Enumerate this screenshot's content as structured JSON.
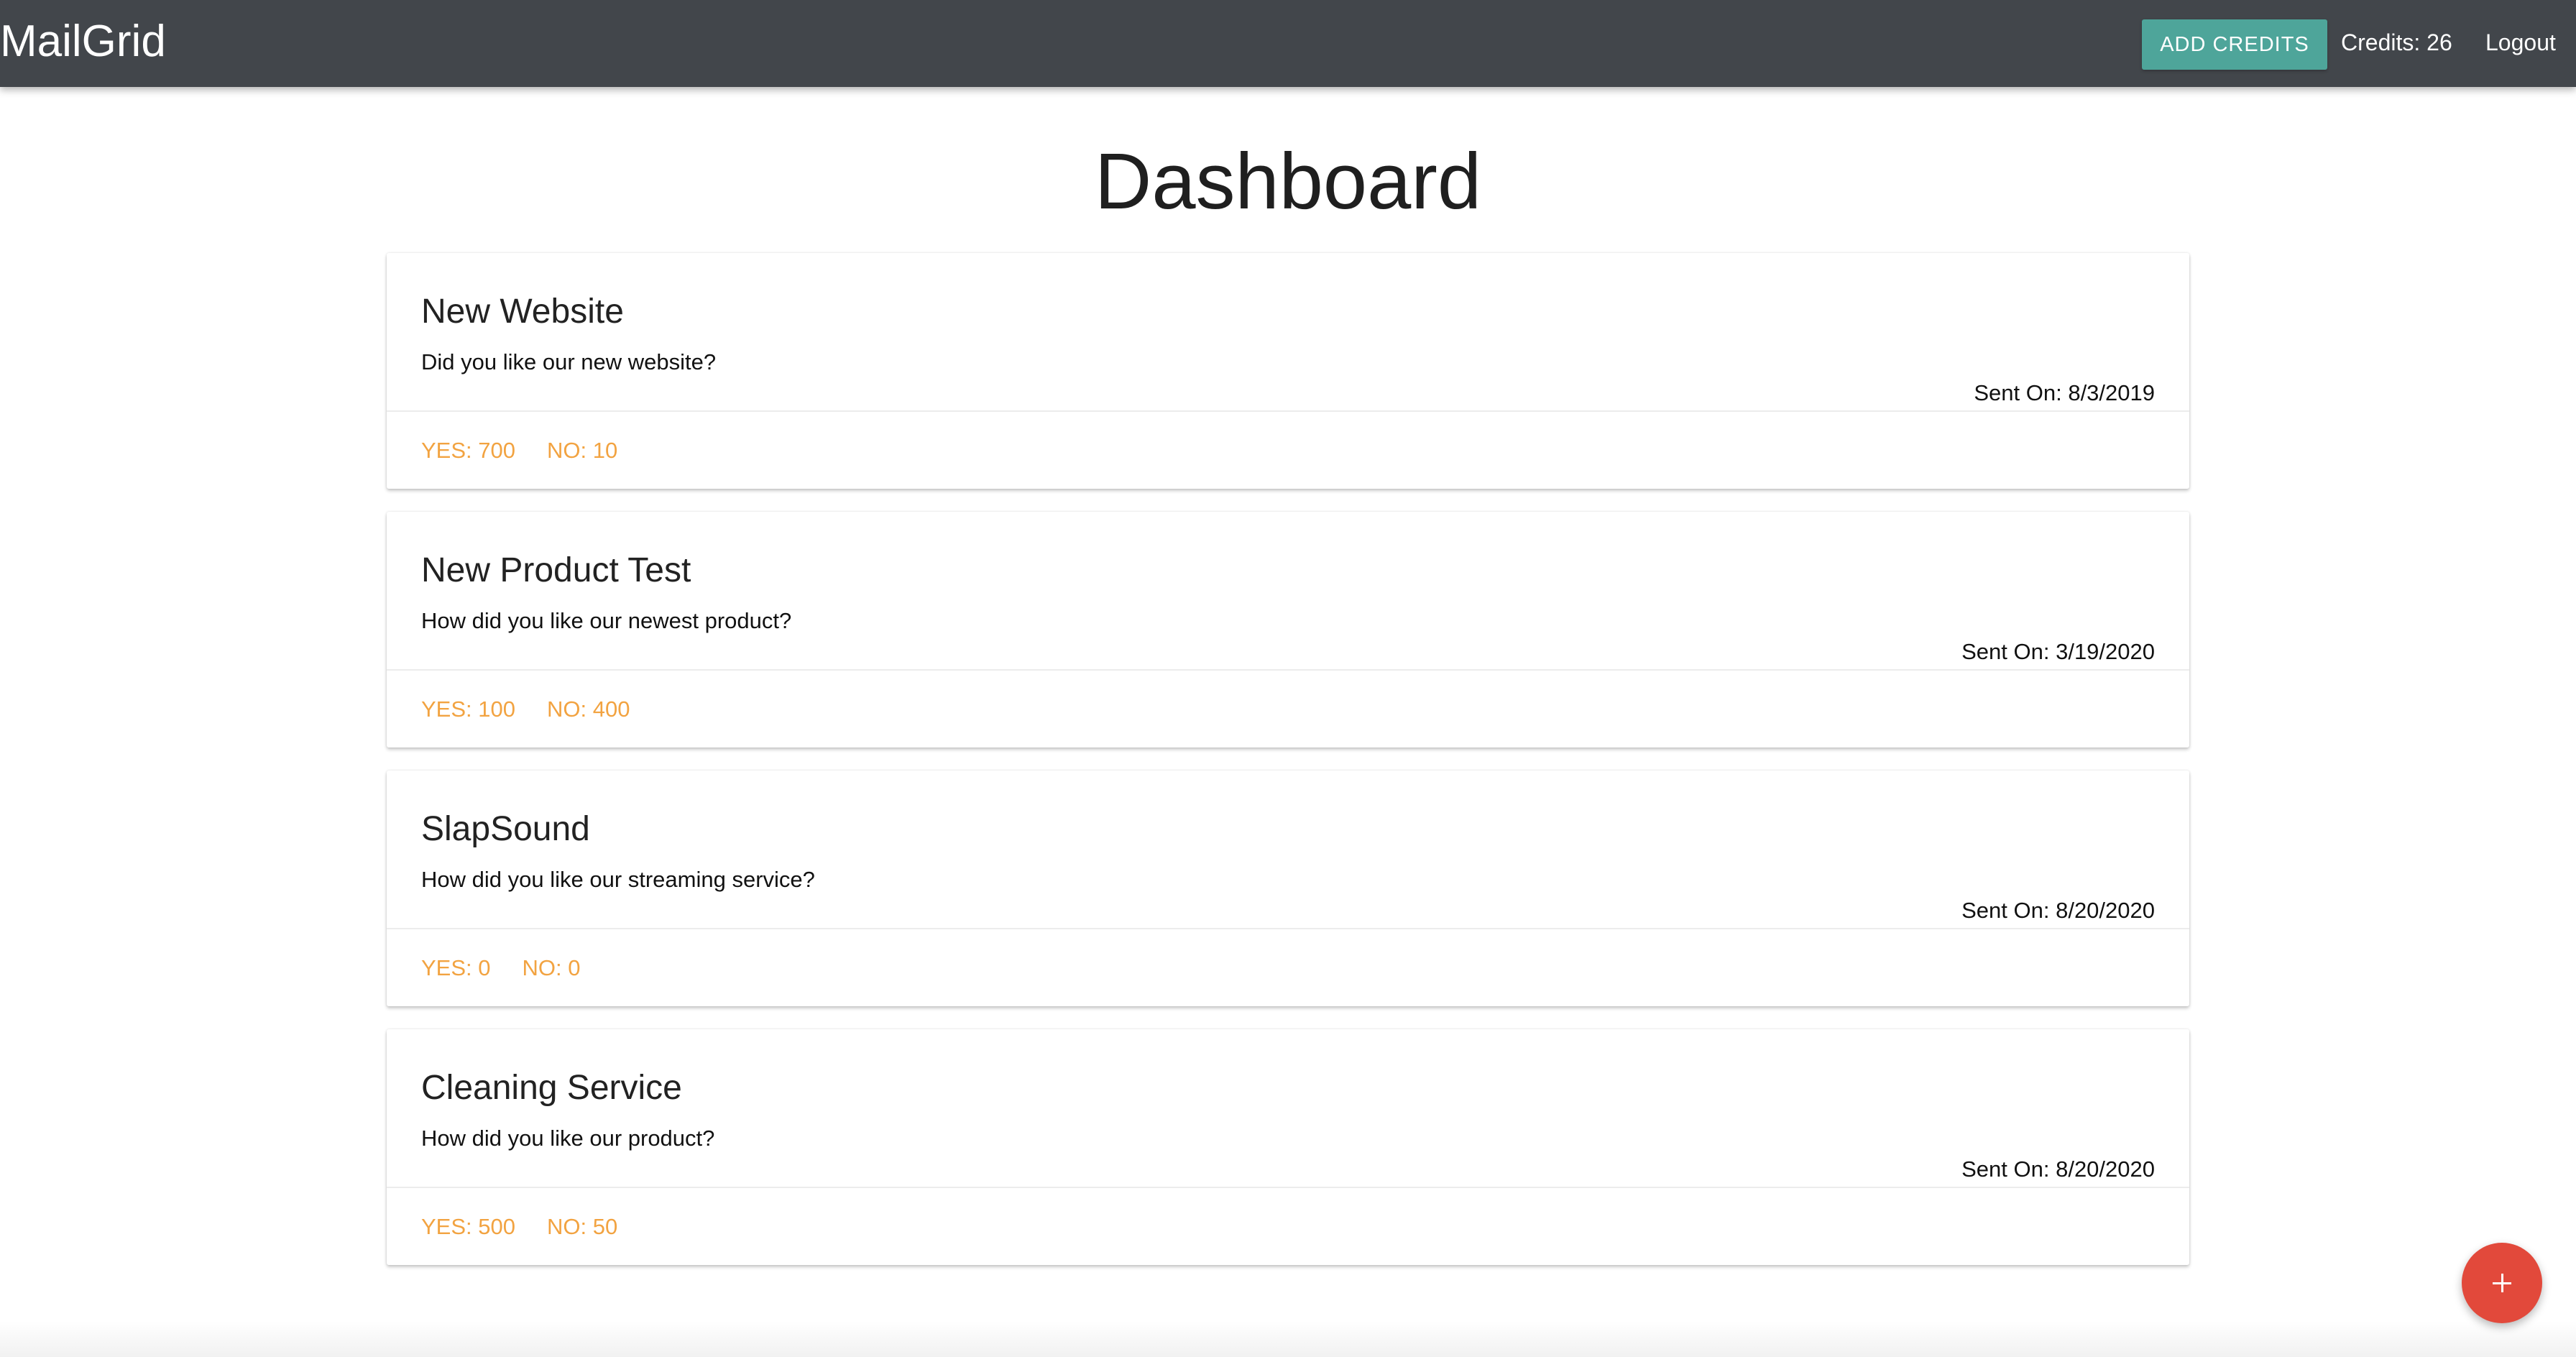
{
  "header": {
    "brand": "MailGrid",
    "add_credits_label": "Add Credits",
    "credits_text": "Credits: 26",
    "logout_label": "Logout"
  },
  "page": {
    "title": "Dashboard"
  },
  "surveys": [
    {
      "title": "New Website",
      "question": "Did you like our new website?",
      "sent_on": "Sent On: 8/3/2019",
      "yes": "Yes: 700",
      "no": "No: 10"
    },
    {
      "title": "New Product Test",
      "question": "How did you like our newest product?",
      "sent_on": "Sent On: 3/19/2020",
      "yes": "Yes: 100",
      "no": "No: 400"
    },
    {
      "title": "SlapSound",
      "question": "How did you like our streaming service?",
      "sent_on": "Sent On: 8/20/2020",
      "yes": "Yes: 0",
      "no": "No: 0"
    },
    {
      "title": "Cleaning Service",
      "question": "How did you like our product?",
      "sent_on": "Sent On: 8/20/2020",
      "yes": "Yes: 500",
      "no": "No: 50"
    }
  ],
  "fab": {
    "icon": "add-icon"
  },
  "colors": {
    "navbar": "#42464b",
    "add_credits": "#4ea59a",
    "vote_text": "#f2a341",
    "fab": "#e2493b"
  }
}
